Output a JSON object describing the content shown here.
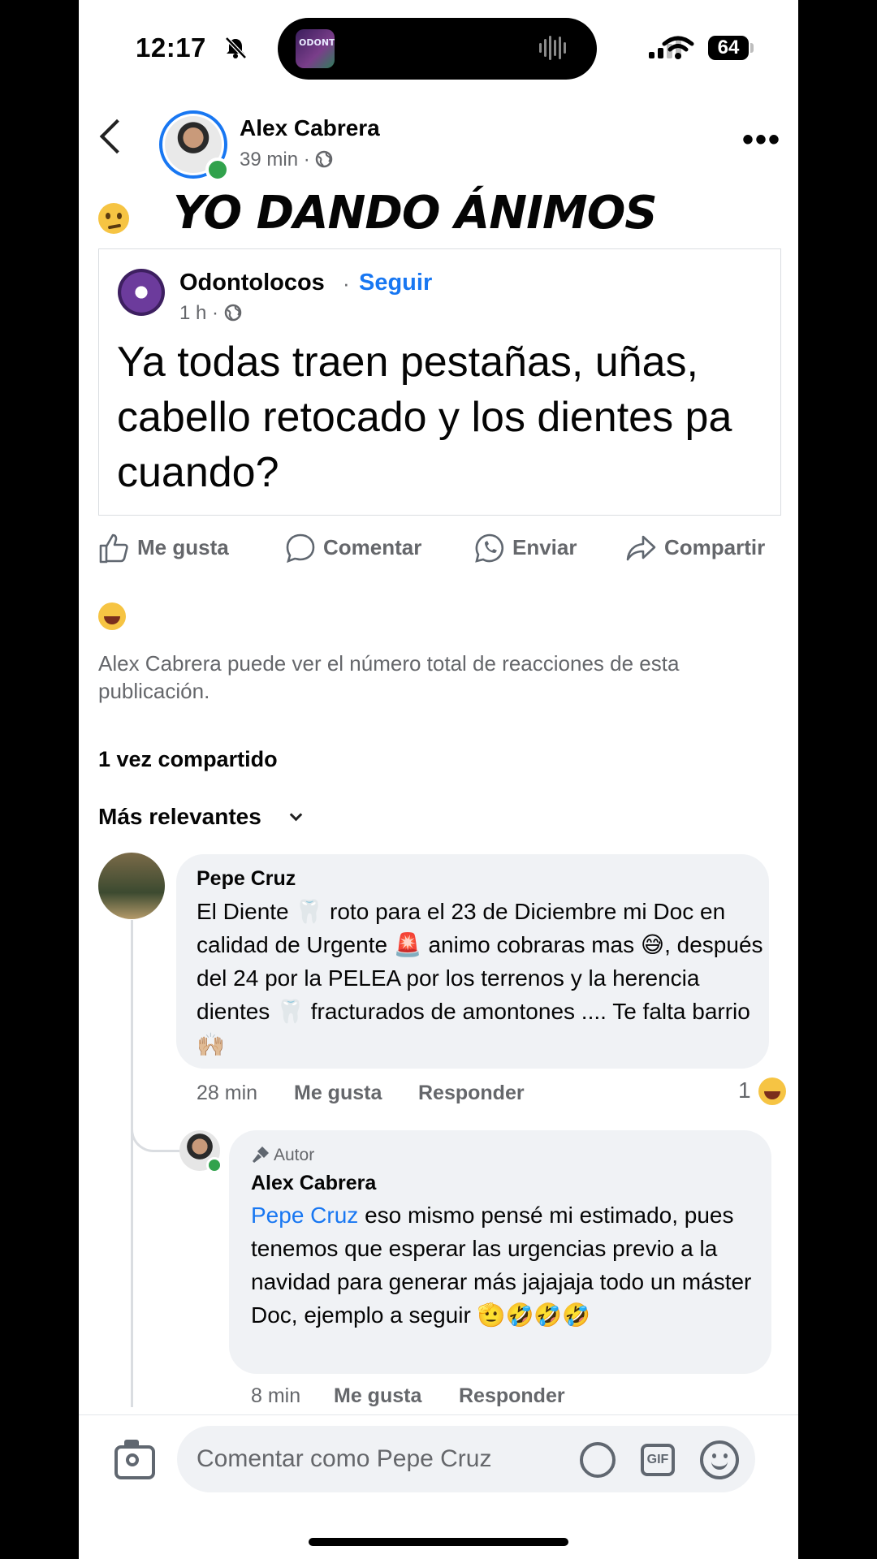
{
  "status_bar": {
    "time": "12:17",
    "bell_icon": "bell-slash-icon",
    "battery": "64",
    "island_thumb_text": "ODONTOS"
  },
  "post": {
    "author": "Alex Cabrera",
    "time": "39 min",
    "audience_icon": "globe-icon",
    "text": "YO DANDO ÁNIMOS",
    "shared": {
      "page_name": "Odontolocos",
      "follow_label": "Seguir",
      "time": "1 h",
      "text": "Ya todas traen pestañas, uñas, cabello retocado y los dientes pa cuando?"
    }
  },
  "actions": {
    "like": "Me gusta",
    "comment": "Comentar",
    "send": "Enviar",
    "share": "Compartir"
  },
  "reactions_note": "Alex Cabrera puede ver el número total de reacciones de esta publicación.",
  "shares_count": "1 vez compartido",
  "sort_label": "Más relevantes",
  "comments": [
    {
      "author": "Pepe Cruz",
      "text": "El Diente 🦷 roto para el 23 de Diciembre mi Doc en calidad de Urgente 🚨 animo cobraras mas 😅, después del 24 por la PELEA por los terrenos y la herencia dientes 🦷 fracturados de amontones .... Te falta barrio 🙌🏼",
      "time": "28 min",
      "like_label": "Me gusta",
      "reply_label": "Responder",
      "reaction_count": "1"
    }
  ],
  "reply": {
    "badge": "Autor",
    "author": "Alex Cabrera",
    "mention": "Pepe Cruz",
    "text": " eso mismo pensé mi estimado, pues tenemos que esperar las urgencias previo a la navidad para generar más jajajaja todo un máster Doc, ejemplo a seguir 🫡🤣🤣🤣",
    "time": "8 min",
    "like_label": "Me gusta",
    "reply_label": "Responder"
  },
  "composer": {
    "placeholder": "Comentar como Pepe Cruz",
    "gif_label": "GIF"
  }
}
